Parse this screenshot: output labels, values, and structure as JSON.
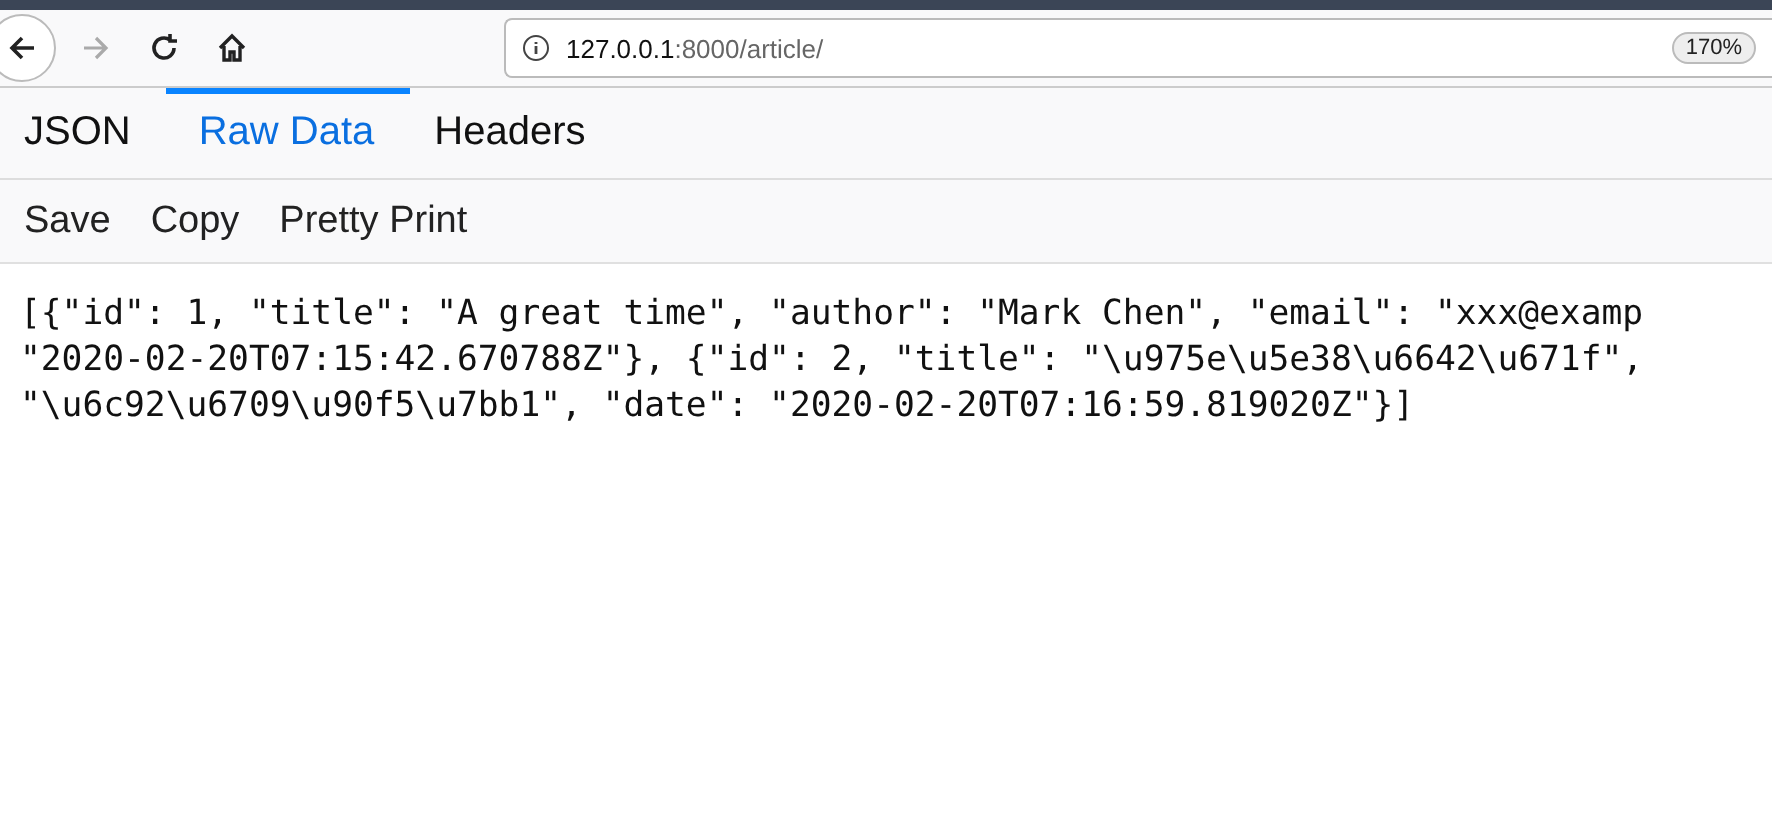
{
  "browser": {
    "url_host": "127.0.0.1",
    "url_path": ":8000/article/",
    "zoom": "170%",
    "forward_disabled": true
  },
  "tabs": [
    {
      "label": "JSON",
      "selected": false
    },
    {
      "label": "Raw Data",
      "selected": true
    },
    {
      "label": "Headers",
      "selected": false
    }
  ],
  "toolbar": [
    "Save",
    "Copy",
    "Pretty Print"
  ],
  "raw_lines": [
    "[{\"id\": 1, \"title\": \"A great time\", \"author\": \"Mark Chen\", \"email\": \"xxx@examp",
    "\"2020-02-20T07:15:42.670788Z\"}, {\"id\": 2, \"title\": \"\\u975e\\u5e38\\u6642\\u671f\",",
    "\"\\u6c92\\u6709\\u90f5\\u7bb1\", \"date\": \"2020-02-20T07:16:59.819020Z\"}]"
  ]
}
